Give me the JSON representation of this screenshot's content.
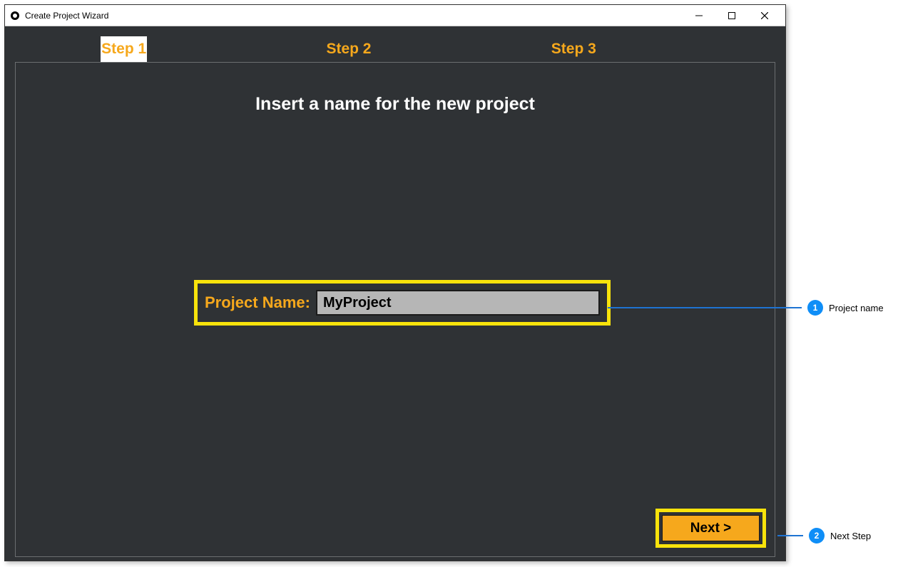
{
  "window": {
    "title": "Create Project Wizard"
  },
  "tabs": {
    "step1": "Step 1",
    "step2": "Step 2",
    "step3": "Step 3"
  },
  "heading": "Insert a name for the new project",
  "form": {
    "label": "Project Name:",
    "value": "MyProject"
  },
  "buttons": {
    "next": "Next >"
  },
  "callouts": {
    "c1": {
      "num": "1",
      "text": "Project name"
    },
    "c2": {
      "num": "2",
      "text": "Next Step"
    }
  }
}
